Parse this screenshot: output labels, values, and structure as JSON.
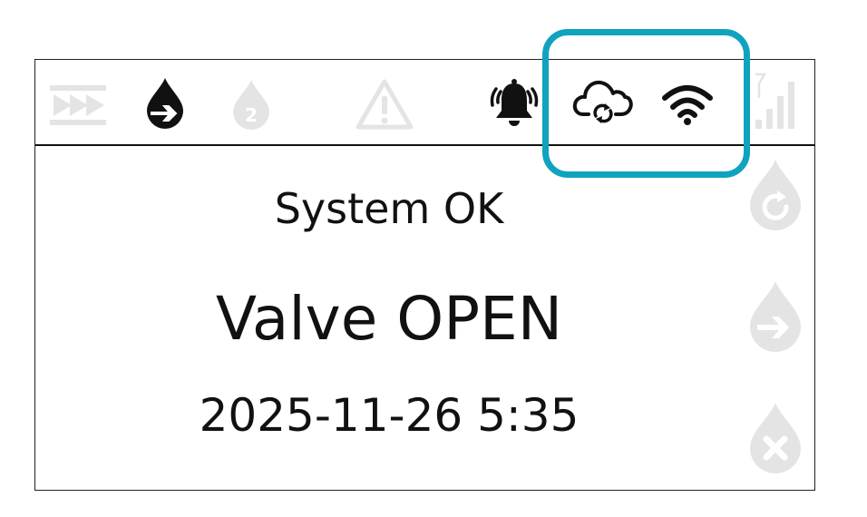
{
  "status_bar": {
    "icons": [
      {
        "name": "fast-forward-icon",
        "state": "inactive"
      },
      {
        "name": "water-drop-arrow-icon",
        "state": "active"
      },
      {
        "name": "water-drop-2-icon",
        "state": "inactive"
      },
      {
        "name": "warning-triangle-icon",
        "state": "inactive"
      },
      {
        "name": "alarm-bell-icon",
        "state": "active"
      },
      {
        "name": "cloud-sync-icon",
        "state": "active"
      },
      {
        "name": "wifi-icon",
        "state": "active"
      },
      {
        "name": "cellular-signal-icon",
        "state": "inactive"
      }
    ]
  },
  "main": {
    "system_status": "System OK",
    "valve_state": "Valve OPEN",
    "datetime": "2025-11-26 5:35"
  },
  "side_buttons": [
    {
      "name": "water-drop-refresh-icon",
      "state": "inactive"
    },
    {
      "name": "water-drop-arrow-icon",
      "state": "inactive"
    },
    {
      "name": "water-drop-close-icon",
      "state": "inactive"
    }
  ],
  "colors": {
    "active_icon": "#111111",
    "inactive_icon": "#e4e4e4",
    "highlight": "#0fa3bf",
    "background": "#ffffff"
  }
}
